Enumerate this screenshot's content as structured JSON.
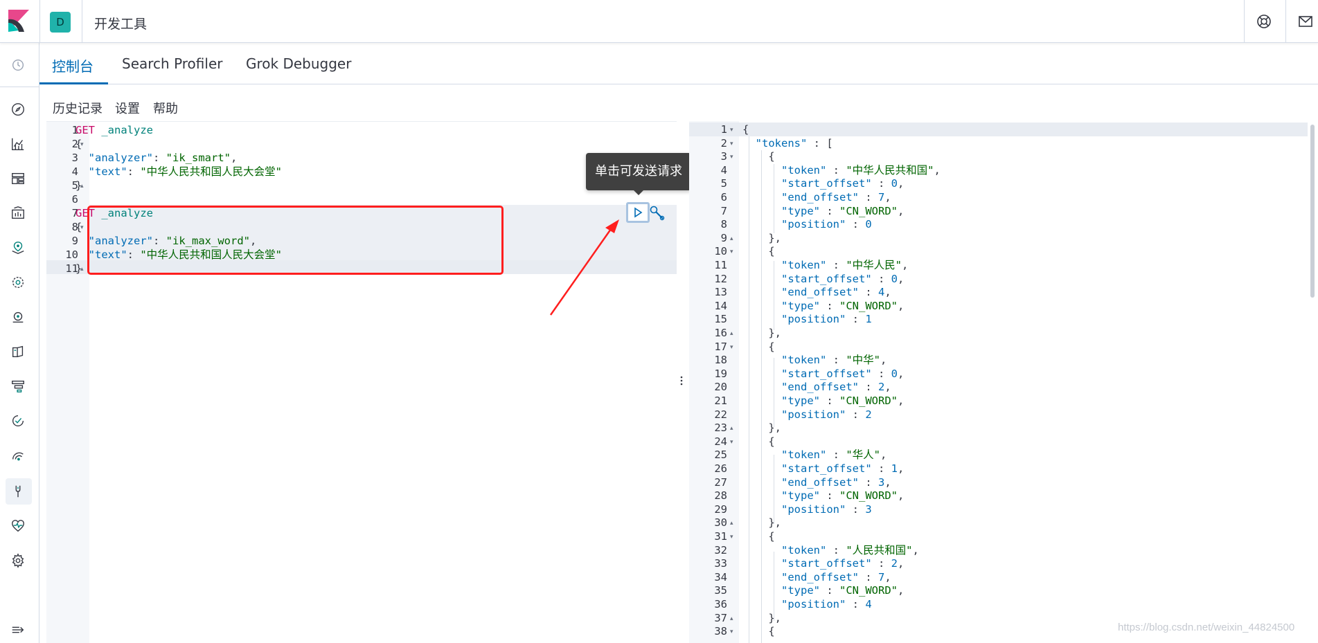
{
  "header": {
    "space_initial": "D",
    "app_title": "开发工具",
    "icons": [
      "kibana-logo-icon",
      "help-lifebuoy-icon",
      "mail-icon"
    ]
  },
  "sidenav": {
    "icons": [
      "recently-viewed-clock-icon",
      "discover-compass-icon",
      "visualize-chart-icon",
      "dashboard-icon",
      "canvas-icon",
      "maps-icon",
      "machine-learning-icon",
      "infrastructure-icon",
      "logs-icon",
      "apm-icon",
      "uptime-icon",
      "siem-icon",
      "dev-tools-wrench-icon",
      "monitoring-heartbeat-icon",
      "management-gear-icon",
      "collapse-menu-icon"
    ]
  },
  "tabs": [
    {
      "label": "控制台",
      "active": true
    },
    {
      "label": "Search Profiler",
      "active": false
    },
    {
      "label": "Grok Debugger",
      "active": false
    }
  ],
  "submenu": {
    "history": "历史记录",
    "settings": "设置",
    "help": "帮助"
  },
  "editor": {
    "lines": [
      {
        "n": "1",
        "fold": "",
        "parts": [
          [
            "m",
            "GET"
          ],
          [
            "u",
            " _analyze"
          ]
        ]
      },
      {
        "n": "2",
        "fold": "▾",
        "parts": [
          [
            "p",
            "{"
          ]
        ]
      },
      {
        "n": "3",
        "fold": "",
        "parts": [
          [
            "p",
            "  "
          ],
          [
            "k",
            "\"analyzer\""
          ],
          [
            "p",
            ": "
          ],
          [
            "s",
            "\"ik_smart\""
          ],
          [
            "p",
            ","
          ]
        ]
      },
      {
        "n": "4",
        "fold": "",
        "parts": [
          [
            "p",
            "  "
          ],
          [
            "k",
            "\"text\""
          ],
          [
            "p",
            ": "
          ],
          [
            "s",
            "\"中华人民共和国人民大会堂\""
          ]
        ]
      },
      {
        "n": "5",
        "fold": "▴",
        "parts": [
          [
            "p",
            "}"
          ]
        ]
      },
      {
        "n": "6",
        "fold": "",
        "parts": []
      },
      {
        "n": "7",
        "fold": "",
        "parts": [
          [
            "m",
            "GET"
          ],
          [
            "u",
            " _analyze"
          ]
        ]
      },
      {
        "n": "8",
        "fold": "▾",
        "parts": [
          [
            "p",
            "{"
          ]
        ]
      },
      {
        "n": "9",
        "fold": "",
        "parts": [
          [
            "p",
            "  "
          ],
          [
            "k",
            "\"analyzer\""
          ],
          [
            "p",
            ": "
          ],
          [
            "s",
            "\"ik_max_word\""
          ],
          [
            "p",
            ","
          ]
        ]
      },
      {
        "n": "10",
        "fold": "",
        "parts": [
          [
            "p",
            "  "
          ],
          [
            "k",
            "\"text\""
          ],
          [
            "p",
            ": "
          ],
          [
            "s",
            "\"中华人民共和国人民大会堂\""
          ]
        ]
      },
      {
        "n": "11",
        "fold": "▴",
        "parts": [
          [
            "p",
            "}"
          ]
        ]
      }
    ]
  },
  "tooltip": {
    "text": "单击可发送请求"
  },
  "output": {
    "lines": [
      {
        "n": "1",
        "fold": "▾",
        "parts": [
          [
            "p",
            "{"
          ]
        ]
      },
      {
        "n": "2",
        "fold": "▾",
        "parts": [
          [
            "p",
            "  "
          ],
          [
            "k",
            "\"tokens\""
          ],
          [
            "p",
            " : ["
          ]
        ]
      },
      {
        "n": "3",
        "fold": "▾",
        "parts": [
          [
            "p",
            "    {"
          ]
        ]
      },
      {
        "n": "4",
        "fold": "",
        "parts": [
          [
            "p",
            "      "
          ],
          [
            "k",
            "\"token\""
          ],
          [
            "p",
            " : "
          ],
          [
            "s",
            "\"中华人民共和国\""
          ],
          [
            "p",
            ","
          ]
        ]
      },
      {
        "n": "5",
        "fold": "",
        "parts": [
          [
            "p",
            "      "
          ],
          [
            "k",
            "\"start_offset\""
          ],
          [
            "p",
            " : "
          ],
          [
            "n",
            "0"
          ],
          [
            "p",
            ","
          ]
        ]
      },
      {
        "n": "6",
        "fold": "",
        "parts": [
          [
            "p",
            "      "
          ],
          [
            "k",
            "\"end_offset\""
          ],
          [
            "p",
            " : "
          ],
          [
            "n",
            "7"
          ],
          [
            "p",
            ","
          ]
        ]
      },
      {
        "n": "7",
        "fold": "",
        "parts": [
          [
            "p",
            "      "
          ],
          [
            "k",
            "\"type\""
          ],
          [
            "p",
            " : "
          ],
          [
            "s",
            "\"CN_WORD\""
          ],
          [
            "p",
            ","
          ]
        ]
      },
      {
        "n": "8",
        "fold": "",
        "parts": [
          [
            "p",
            "      "
          ],
          [
            "k",
            "\"position\""
          ],
          [
            "p",
            " : "
          ],
          [
            "n",
            "0"
          ]
        ]
      },
      {
        "n": "9",
        "fold": "▴",
        "parts": [
          [
            "p",
            "    },"
          ]
        ]
      },
      {
        "n": "10",
        "fold": "▾",
        "parts": [
          [
            "p",
            "    {"
          ]
        ]
      },
      {
        "n": "11",
        "fold": "",
        "parts": [
          [
            "p",
            "      "
          ],
          [
            "k",
            "\"token\""
          ],
          [
            "p",
            " : "
          ],
          [
            "s",
            "\"中华人民\""
          ],
          [
            "p",
            ","
          ]
        ]
      },
      {
        "n": "12",
        "fold": "",
        "parts": [
          [
            "p",
            "      "
          ],
          [
            "k",
            "\"start_offset\""
          ],
          [
            "p",
            " : "
          ],
          [
            "n",
            "0"
          ],
          [
            "p",
            ","
          ]
        ]
      },
      {
        "n": "13",
        "fold": "",
        "parts": [
          [
            "p",
            "      "
          ],
          [
            "k",
            "\"end_offset\""
          ],
          [
            "p",
            " : "
          ],
          [
            "n",
            "4"
          ],
          [
            "p",
            ","
          ]
        ]
      },
      {
        "n": "14",
        "fold": "",
        "parts": [
          [
            "p",
            "      "
          ],
          [
            "k",
            "\"type\""
          ],
          [
            "p",
            " : "
          ],
          [
            "s",
            "\"CN_WORD\""
          ],
          [
            "p",
            ","
          ]
        ]
      },
      {
        "n": "15",
        "fold": "",
        "parts": [
          [
            "p",
            "      "
          ],
          [
            "k",
            "\"position\""
          ],
          [
            "p",
            " : "
          ],
          [
            "n",
            "1"
          ]
        ]
      },
      {
        "n": "16",
        "fold": "▴",
        "parts": [
          [
            "p",
            "    },"
          ]
        ]
      },
      {
        "n": "17",
        "fold": "▾",
        "parts": [
          [
            "p",
            "    {"
          ]
        ]
      },
      {
        "n": "18",
        "fold": "",
        "parts": [
          [
            "p",
            "      "
          ],
          [
            "k",
            "\"token\""
          ],
          [
            "p",
            " : "
          ],
          [
            "s",
            "\"中华\""
          ],
          [
            "p",
            ","
          ]
        ]
      },
      {
        "n": "19",
        "fold": "",
        "parts": [
          [
            "p",
            "      "
          ],
          [
            "k",
            "\"start_offset\""
          ],
          [
            "p",
            " : "
          ],
          [
            "n",
            "0"
          ],
          [
            "p",
            ","
          ]
        ]
      },
      {
        "n": "20",
        "fold": "",
        "parts": [
          [
            "p",
            "      "
          ],
          [
            "k",
            "\"end_offset\""
          ],
          [
            "p",
            " : "
          ],
          [
            "n",
            "2"
          ],
          [
            "p",
            ","
          ]
        ]
      },
      {
        "n": "21",
        "fold": "",
        "parts": [
          [
            "p",
            "      "
          ],
          [
            "k",
            "\"type\""
          ],
          [
            "p",
            " : "
          ],
          [
            "s",
            "\"CN_WORD\""
          ],
          [
            "p",
            ","
          ]
        ]
      },
      {
        "n": "22",
        "fold": "",
        "parts": [
          [
            "p",
            "      "
          ],
          [
            "k",
            "\"position\""
          ],
          [
            "p",
            " : "
          ],
          [
            "n",
            "2"
          ]
        ]
      },
      {
        "n": "23",
        "fold": "▴",
        "parts": [
          [
            "p",
            "    },"
          ]
        ]
      },
      {
        "n": "24",
        "fold": "▾",
        "parts": [
          [
            "p",
            "    {"
          ]
        ]
      },
      {
        "n": "25",
        "fold": "",
        "parts": [
          [
            "p",
            "      "
          ],
          [
            "k",
            "\"token\""
          ],
          [
            "p",
            " : "
          ],
          [
            "s",
            "\"华人\""
          ],
          [
            "p",
            ","
          ]
        ]
      },
      {
        "n": "26",
        "fold": "",
        "parts": [
          [
            "p",
            "      "
          ],
          [
            "k",
            "\"start_offset\""
          ],
          [
            "p",
            " : "
          ],
          [
            "n",
            "1"
          ],
          [
            "p",
            ","
          ]
        ]
      },
      {
        "n": "27",
        "fold": "",
        "parts": [
          [
            "p",
            "      "
          ],
          [
            "k",
            "\"end_offset\""
          ],
          [
            "p",
            " : "
          ],
          [
            "n",
            "3"
          ],
          [
            "p",
            ","
          ]
        ]
      },
      {
        "n": "28",
        "fold": "",
        "parts": [
          [
            "p",
            "      "
          ],
          [
            "k",
            "\"type\""
          ],
          [
            "p",
            " : "
          ],
          [
            "s",
            "\"CN_WORD\""
          ],
          [
            "p",
            ","
          ]
        ]
      },
      {
        "n": "29",
        "fold": "",
        "parts": [
          [
            "p",
            "      "
          ],
          [
            "k",
            "\"position\""
          ],
          [
            "p",
            " : "
          ],
          [
            "n",
            "3"
          ]
        ]
      },
      {
        "n": "30",
        "fold": "▴",
        "parts": [
          [
            "p",
            "    },"
          ]
        ]
      },
      {
        "n": "31",
        "fold": "▾",
        "parts": [
          [
            "p",
            "    {"
          ]
        ]
      },
      {
        "n": "32",
        "fold": "",
        "parts": [
          [
            "p",
            "      "
          ],
          [
            "k",
            "\"token\""
          ],
          [
            "p",
            " : "
          ],
          [
            "s",
            "\"人民共和国\""
          ],
          [
            "p",
            ","
          ]
        ]
      },
      {
        "n": "33",
        "fold": "",
        "parts": [
          [
            "p",
            "      "
          ],
          [
            "k",
            "\"start_offset\""
          ],
          [
            "p",
            " : "
          ],
          [
            "n",
            "2"
          ],
          [
            "p",
            ","
          ]
        ]
      },
      {
        "n": "34",
        "fold": "",
        "parts": [
          [
            "p",
            "      "
          ],
          [
            "k",
            "\"end_offset\""
          ],
          [
            "p",
            " : "
          ],
          [
            "n",
            "7"
          ],
          [
            "p",
            ","
          ]
        ]
      },
      {
        "n": "35",
        "fold": "",
        "parts": [
          [
            "p",
            "      "
          ],
          [
            "k",
            "\"type\""
          ],
          [
            "p",
            " : "
          ],
          [
            "s",
            "\"CN_WORD\""
          ],
          [
            "p",
            ","
          ]
        ]
      },
      {
        "n": "36",
        "fold": "",
        "parts": [
          [
            "p",
            "      "
          ],
          [
            "k",
            "\"position\""
          ],
          [
            "p",
            " : "
          ],
          [
            "n",
            "4"
          ]
        ]
      },
      {
        "n": "37",
        "fold": "▴",
        "parts": [
          [
            "p",
            "    },"
          ]
        ]
      },
      {
        "n": "38",
        "fold": "▾",
        "parts": [
          [
            "p",
            "    {"
          ]
        ]
      }
    ]
  },
  "watermark": "https://blog.csdn.net/weixin_44824500",
  "colors": {
    "accent": "#006bb4",
    "method": "#c80a68",
    "url": "#00817a",
    "string": "#006400",
    "highlight_box": "#ff1e1e",
    "tooltip_bg": "#404040"
  }
}
